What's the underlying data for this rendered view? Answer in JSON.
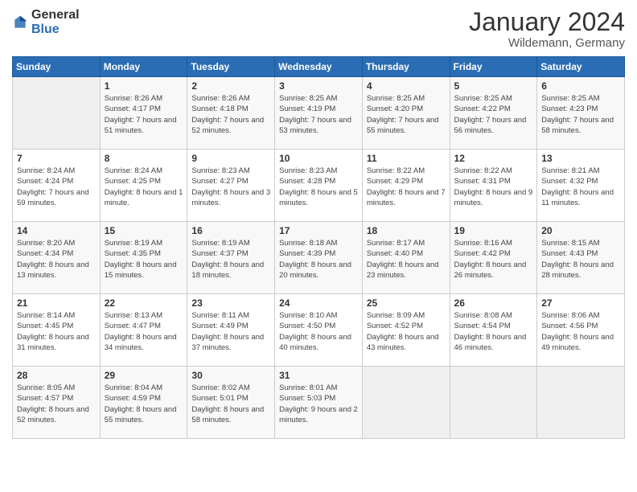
{
  "header": {
    "logo_general": "General",
    "logo_blue": "Blue",
    "month": "January 2024",
    "location": "Wildemann, Germany"
  },
  "weekdays": [
    "Sunday",
    "Monday",
    "Tuesday",
    "Wednesday",
    "Thursday",
    "Friday",
    "Saturday"
  ],
  "weeks": [
    [
      {
        "day": "",
        "sunrise": "",
        "sunset": "",
        "daylight": ""
      },
      {
        "day": "1",
        "sunrise": "Sunrise: 8:26 AM",
        "sunset": "Sunset: 4:17 PM",
        "daylight": "Daylight: 7 hours and 51 minutes."
      },
      {
        "day": "2",
        "sunrise": "Sunrise: 8:26 AM",
        "sunset": "Sunset: 4:18 PM",
        "daylight": "Daylight: 7 hours and 52 minutes."
      },
      {
        "day": "3",
        "sunrise": "Sunrise: 8:25 AM",
        "sunset": "Sunset: 4:19 PM",
        "daylight": "Daylight: 7 hours and 53 minutes."
      },
      {
        "day": "4",
        "sunrise": "Sunrise: 8:25 AM",
        "sunset": "Sunset: 4:20 PM",
        "daylight": "Daylight: 7 hours and 55 minutes."
      },
      {
        "day": "5",
        "sunrise": "Sunrise: 8:25 AM",
        "sunset": "Sunset: 4:22 PM",
        "daylight": "Daylight: 7 hours and 56 minutes."
      },
      {
        "day": "6",
        "sunrise": "Sunrise: 8:25 AM",
        "sunset": "Sunset: 4:23 PM",
        "daylight": "Daylight: 7 hours and 58 minutes."
      }
    ],
    [
      {
        "day": "7",
        "sunrise": "Sunrise: 8:24 AM",
        "sunset": "Sunset: 4:24 PM",
        "daylight": "Daylight: 7 hours and 59 minutes."
      },
      {
        "day": "8",
        "sunrise": "Sunrise: 8:24 AM",
        "sunset": "Sunset: 4:25 PM",
        "daylight": "Daylight: 8 hours and 1 minute."
      },
      {
        "day": "9",
        "sunrise": "Sunrise: 8:23 AM",
        "sunset": "Sunset: 4:27 PM",
        "daylight": "Daylight: 8 hours and 3 minutes."
      },
      {
        "day": "10",
        "sunrise": "Sunrise: 8:23 AM",
        "sunset": "Sunset: 4:28 PM",
        "daylight": "Daylight: 8 hours and 5 minutes."
      },
      {
        "day": "11",
        "sunrise": "Sunrise: 8:22 AM",
        "sunset": "Sunset: 4:29 PM",
        "daylight": "Daylight: 8 hours and 7 minutes."
      },
      {
        "day": "12",
        "sunrise": "Sunrise: 8:22 AM",
        "sunset": "Sunset: 4:31 PM",
        "daylight": "Daylight: 8 hours and 9 minutes."
      },
      {
        "day": "13",
        "sunrise": "Sunrise: 8:21 AM",
        "sunset": "Sunset: 4:32 PM",
        "daylight": "Daylight: 8 hours and 11 minutes."
      }
    ],
    [
      {
        "day": "14",
        "sunrise": "Sunrise: 8:20 AM",
        "sunset": "Sunset: 4:34 PM",
        "daylight": "Daylight: 8 hours and 13 minutes."
      },
      {
        "day": "15",
        "sunrise": "Sunrise: 8:19 AM",
        "sunset": "Sunset: 4:35 PM",
        "daylight": "Daylight: 8 hours and 15 minutes."
      },
      {
        "day": "16",
        "sunrise": "Sunrise: 8:19 AM",
        "sunset": "Sunset: 4:37 PM",
        "daylight": "Daylight: 8 hours and 18 minutes."
      },
      {
        "day": "17",
        "sunrise": "Sunrise: 8:18 AM",
        "sunset": "Sunset: 4:39 PM",
        "daylight": "Daylight: 8 hours and 20 minutes."
      },
      {
        "day": "18",
        "sunrise": "Sunrise: 8:17 AM",
        "sunset": "Sunset: 4:40 PM",
        "daylight": "Daylight: 8 hours and 23 minutes."
      },
      {
        "day": "19",
        "sunrise": "Sunrise: 8:16 AM",
        "sunset": "Sunset: 4:42 PM",
        "daylight": "Daylight: 8 hours and 26 minutes."
      },
      {
        "day": "20",
        "sunrise": "Sunrise: 8:15 AM",
        "sunset": "Sunset: 4:43 PM",
        "daylight": "Daylight: 8 hours and 28 minutes."
      }
    ],
    [
      {
        "day": "21",
        "sunrise": "Sunrise: 8:14 AM",
        "sunset": "Sunset: 4:45 PM",
        "daylight": "Daylight: 8 hours and 31 minutes."
      },
      {
        "day": "22",
        "sunrise": "Sunrise: 8:13 AM",
        "sunset": "Sunset: 4:47 PM",
        "daylight": "Daylight: 8 hours and 34 minutes."
      },
      {
        "day": "23",
        "sunrise": "Sunrise: 8:11 AM",
        "sunset": "Sunset: 4:49 PM",
        "daylight": "Daylight: 8 hours and 37 minutes."
      },
      {
        "day": "24",
        "sunrise": "Sunrise: 8:10 AM",
        "sunset": "Sunset: 4:50 PM",
        "daylight": "Daylight: 8 hours and 40 minutes."
      },
      {
        "day": "25",
        "sunrise": "Sunrise: 8:09 AM",
        "sunset": "Sunset: 4:52 PM",
        "daylight": "Daylight: 8 hours and 43 minutes."
      },
      {
        "day": "26",
        "sunrise": "Sunrise: 8:08 AM",
        "sunset": "Sunset: 4:54 PM",
        "daylight": "Daylight: 8 hours and 46 minutes."
      },
      {
        "day": "27",
        "sunrise": "Sunrise: 8:06 AM",
        "sunset": "Sunset: 4:56 PM",
        "daylight": "Daylight: 8 hours and 49 minutes."
      }
    ],
    [
      {
        "day": "28",
        "sunrise": "Sunrise: 8:05 AM",
        "sunset": "Sunset: 4:57 PM",
        "daylight": "Daylight: 8 hours and 52 minutes."
      },
      {
        "day": "29",
        "sunrise": "Sunrise: 8:04 AM",
        "sunset": "Sunset: 4:59 PM",
        "daylight": "Daylight: 8 hours and 55 minutes."
      },
      {
        "day": "30",
        "sunrise": "Sunrise: 8:02 AM",
        "sunset": "Sunset: 5:01 PM",
        "daylight": "Daylight: 8 hours and 58 minutes."
      },
      {
        "day": "31",
        "sunrise": "Sunrise: 8:01 AM",
        "sunset": "Sunset: 5:03 PM",
        "daylight": "Daylight: 9 hours and 2 minutes."
      },
      {
        "day": "",
        "sunrise": "",
        "sunset": "",
        "daylight": ""
      },
      {
        "day": "",
        "sunrise": "",
        "sunset": "",
        "daylight": ""
      },
      {
        "day": "",
        "sunrise": "",
        "sunset": "",
        "daylight": ""
      }
    ]
  ]
}
